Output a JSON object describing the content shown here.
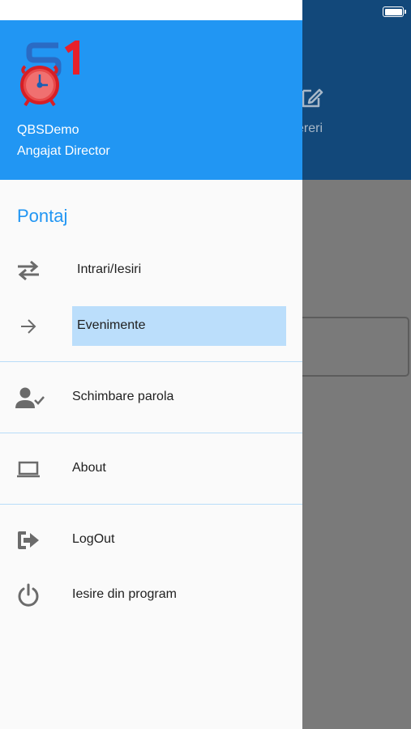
{
  "background": {
    "tab_label": "ereri",
    "tab_icon": "edit-icon"
  },
  "drawer": {
    "header": {
      "logo_text": "S1",
      "app_name": "QBSDemo",
      "user_role": "Angajat Director"
    },
    "section_title": "Pontaj",
    "items": [
      {
        "label": "Intrari/Iesiri",
        "icon": "swap-arrows-icon"
      },
      {
        "label": "Evenimente",
        "icon": "arrow-right-icon",
        "selected": true
      },
      {
        "label": "Schimbare parola",
        "icon": "person-check-icon"
      },
      {
        "label": "About",
        "icon": "laptop-icon"
      },
      {
        "label": "LogOut",
        "icon": "logout-icon"
      },
      {
        "label": "Iesire din program",
        "icon": "power-icon"
      }
    ]
  },
  "colors": {
    "header": "#2196f3",
    "selected": "#bbdefb",
    "section_title": "#2196f3"
  }
}
